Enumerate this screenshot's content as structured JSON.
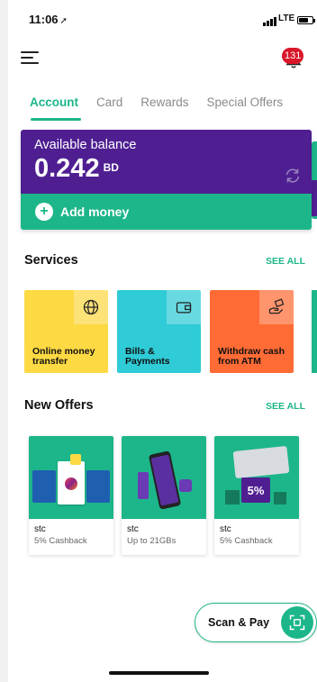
{
  "status_bar": {
    "time": "11:06",
    "network": "LTE"
  },
  "header": {
    "notification_count": "131"
  },
  "tabs": [
    {
      "label": "Account",
      "active": true
    },
    {
      "label": "Card",
      "active": false
    },
    {
      "label": "Rewards",
      "active": false
    },
    {
      "label": "Special Offers",
      "active": false
    }
  ],
  "balance": {
    "label": "Available balance",
    "amount": "0.242",
    "currency": "BD",
    "add_money_label": "Add money"
  },
  "services": {
    "title": "Services",
    "see_all": "SEE ALL",
    "items": [
      {
        "label": "Online money transfer",
        "icon": "globe-icon",
        "color": "#fdd943"
      },
      {
        "label": "Bills & Payments",
        "icon": "wallet-icon",
        "color": "#2fcbd6"
      },
      {
        "label": "Withdraw cash from ATM",
        "icon": "atm-cash-icon",
        "color": "#ff6b35"
      }
    ]
  },
  "offers": {
    "title": "New Offers",
    "see_all": "SEE ALL",
    "items": [
      {
        "brand": "stc",
        "desc": "5% Cashback"
      },
      {
        "brand": "stc",
        "desc": "Up to 21GBs"
      },
      {
        "brand": "stc",
        "desc": "5% Cashback",
        "image_text": "5%"
      }
    ]
  },
  "scan_pay": {
    "label": "Scan & Pay"
  },
  "colors": {
    "accent": "#1db68a",
    "purple": "#4f1f92",
    "badge": "#d9162a"
  }
}
